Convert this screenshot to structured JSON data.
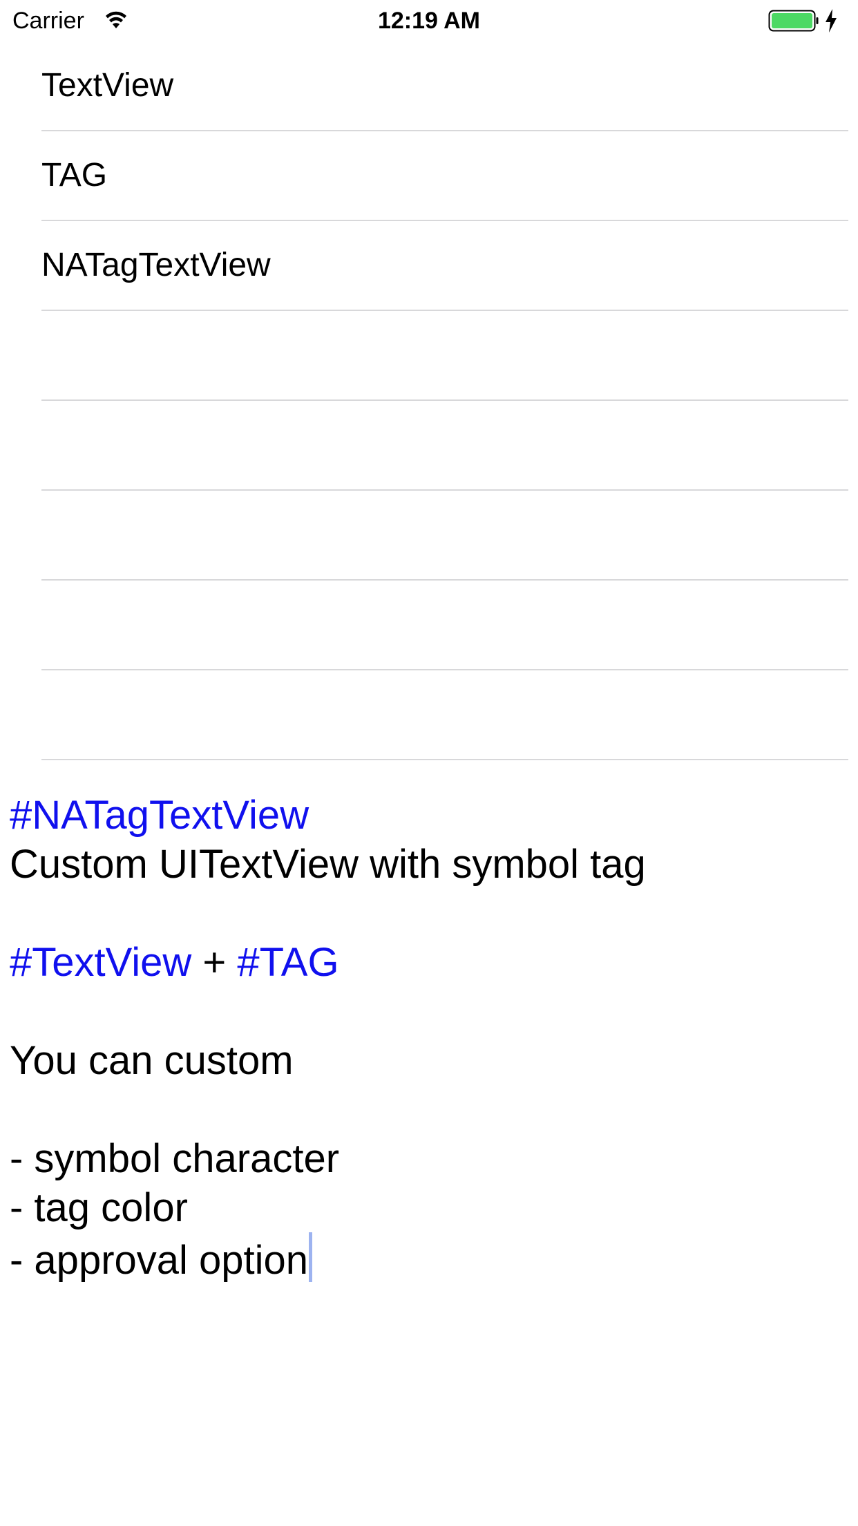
{
  "status_bar": {
    "carrier": "Carrier",
    "time": "12:19 AM",
    "wifi_icon": "wifi-icon",
    "battery_icon": "battery-icon",
    "charging_icon": "charging-bolt-icon",
    "battery_color": "#4cd964"
  },
  "table": {
    "rows": [
      {
        "label": "TextView"
      },
      {
        "label": "TAG"
      },
      {
        "label": "NATagTextView"
      },
      {
        "label": ""
      },
      {
        "label": ""
      },
      {
        "label": ""
      },
      {
        "label": ""
      },
      {
        "label": ""
      }
    ]
  },
  "text_view": {
    "tag_color": "#1010ee",
    "lines": {
      "l1_tag": "#NATagTextView",
      "l2": "Custom UITextView with symbol tag",
      "l4_tag_a": "#TextView",
      "l4_plus": " + ",
      "l4_tag_b": "#TAG",
      "l6": "You can custom",
      "l8": "- symbol character",
      "l9": "- tag color",
      "l10": "- approval option"
    }
  }
}
